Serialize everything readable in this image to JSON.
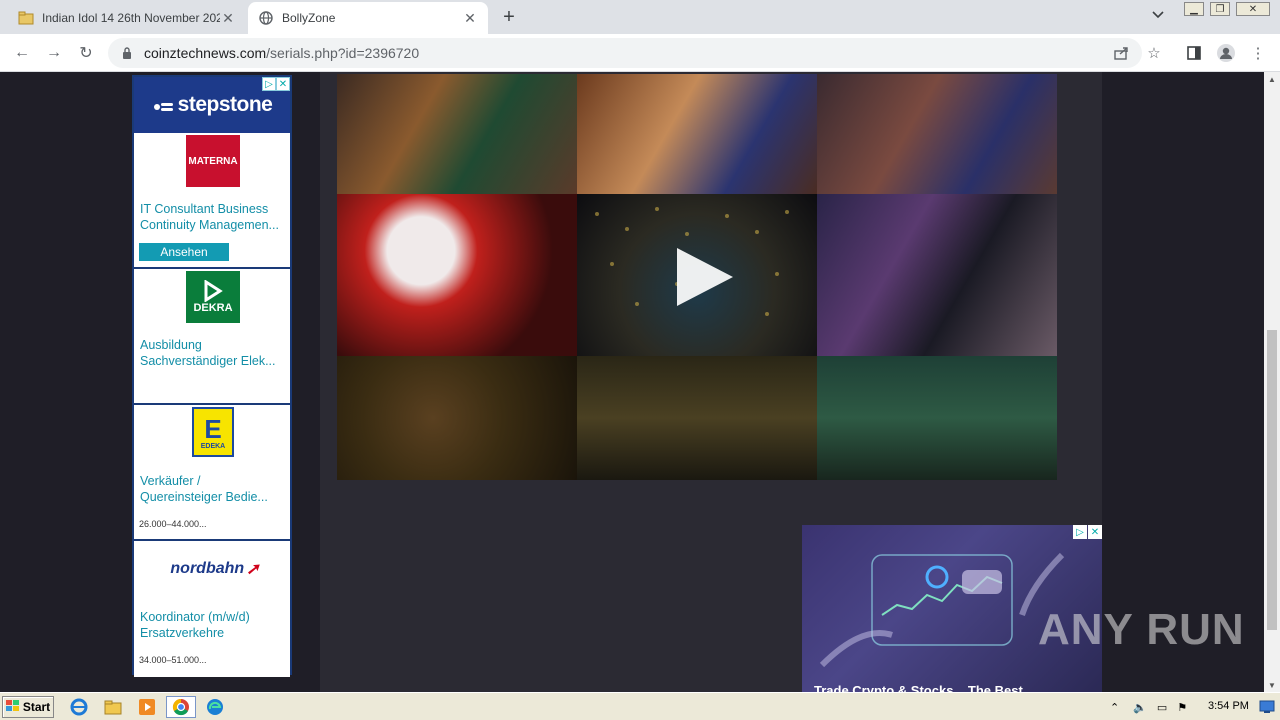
{
  "browser": {
    "tabs": [
      {
        "title": "Indian Idol 14 26th November 2023 ...",
        "active": false
      },
      {
        "title": "BollyZone",
        "active": true
      }
    ],
    "url_host": "coinztechnews.com",
    "url_path": "/serials.php?id=2396720"
  },
  "left_ad": {
    "brand": "stepstone",
    "items": [
      {
        "logo": "MATERNA",
        "line1": "IT Consultant Business",
        "line2": "Continuity Managemen...",
        "cta": "Ansehen",
        "salary": ""
      },
      {
        "logo": "DEKRA",
        "line1": "Ausbildung",
        "line2": "Sachverständiger Elek...",
        "cta": "",
        "salary": ""
      },
      {
        "logo": "EDEKA",
        "line1": "Verkäufer /",
        "line2": "Quereinsteiger Bedie...",
        "cta": "",
        "salary": "26.000–44.000..."
      },
      {
        "logo": "nordbahn",
        "line1": "Koordinator (m/w/d)",
        "line2": "Ersatzverkehre",
        "cta": "",
        "salary": "34.000–51.000..."
      }
    ],
    "colors": {
      "brandbar": "#1d3a8a",
      "text": "#138ea7",
      "cta": "#139bb3"
    }
  },
  "right_ad": {
    "headline": "Trade Crypto & Stocks... The Best"
  },
  "watermark": {
    "text": "ANY RUN"
  },
  "taskbar": {
    "start_label": "Start",
    "clock": "3:54 PM"
  }
}
